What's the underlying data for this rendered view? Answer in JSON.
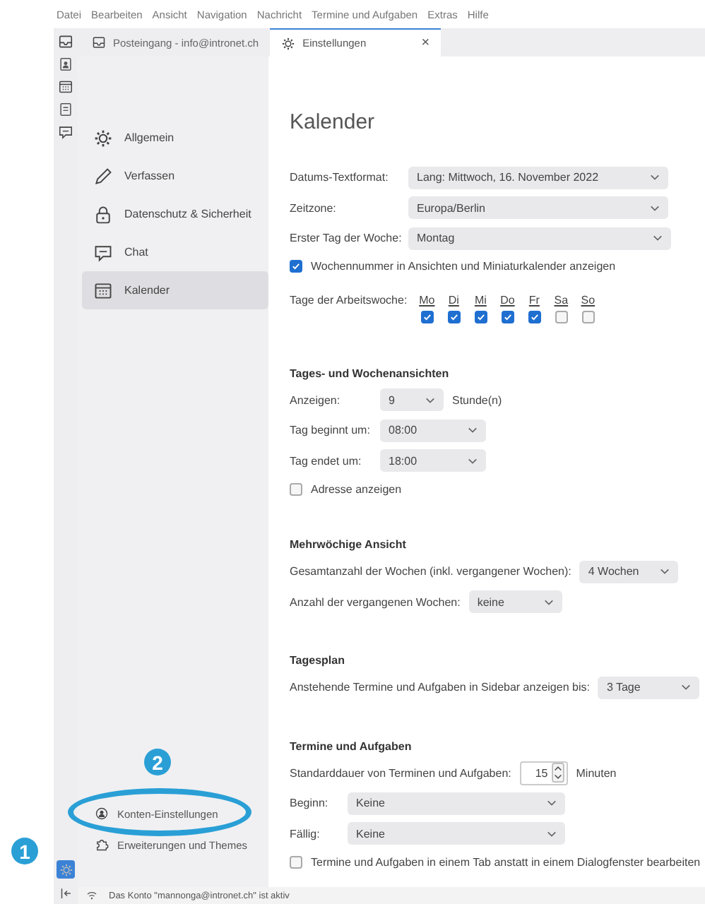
{
  "menu": [
    "Datei",
    "Bearbeiten",
    "Ansicht",
    "Navigation",
    "Nachricht",
    "Termine und Aufgaben",
    "Extras",
    "Hilfe"
  ],
  "tabs": [
    {
      "label": "Posteingang - info@intronet.ch",
      "selected": false
    },
    {
      "label": "Einstellungen",
      "selected": true,
      "close": "×"
    }
  ],
  "sidebar": {
    "items": [
      {
        "label": "Allgemein",
        "selected": false
      },
      {
        "label": "Verfassen",
        "selected": false
      },
      {
        "label": "Datenschutz & Sicherheit",
        "selected": false
      },
      {
        "label": "Chat",
        "selected": false
      },
      {
        "label": "Kalender",
        "selected": true
      }
    ],
    "footer": [
      {
        "label": "Konten-Einstellungen"
      },
      {
        "label": "Erweiterungen und Themes"
      }
    ]
  },
  "content": {
    "title": "Kalender",
    "sections": [
      {
        "rows": [
          {
            "kind": "select",
            "label": "Datums-Textformat:",
            "value": "Lang: Mittwoch, 16. November 2022"
          },
          {
            "kind": "select",
            "label": "Zeitzone:",
            "value": "Europa/Berlin"
          },
          {
            "kind": "select",
            "label": "Erster Tag der Woche:",
            "value": "Montag"
          },
          {
            "kind": "checkbox",
            "label": "Wochennummer in Ansichten und Miniaturkalender anzeigen",
            "checked": true
          },
          {
            "kind": "weekdays",
            "label": "Tage der Arbeitswoche:",
            "days": [
              {
                "label": "Mo",
                "checked": true
              },
              {
                "label": "Di",
                "checked": true
              },
              {
                "label": "Mi",
                "checked": true
              },
              {
                "label": "Do",
                "checked": true
              },
              {
                "label": "Fr",
                "checked": true
              },
              {
                "label": "Sa",
                "checked": false
              },
              {
                "label": "So",
                "checked": false
              }
            ]
          }
        ]
      },
      {
        "heading": "Tages- und Wochenansichten",
        "rows": [
          {
            "kind": "select",
            "label": "Anzeigen:",
            "value": "9",
            "suffix": "Stunde(n)"
          },
          {
            "kind": "select",
            "label": "Tag beginnt um:",
            "value": "08:00"
          },
          {
            "kind": "select",
            "label": "Tag endet um:",
            "value": "18:00"
          },
          {
            "kind": "checkbox",
            "label": "Adresse anzeigen",
            "checked": false
          }
        ]
      },
      {
        "heading": "Mehrwöchige Ansicht",
        "rows": [
          {
            "kind": "select",
            "label": "Gesamtanzahl der Wochen (inkl. vergangener Wochen):",
            "value": "4 Wochen"
          },
          {
            "kind": "select",
            "label": "Anzahl der vergangenen Wochen:",
            "value": "keine"
          }
        ]
      },
      {
        "heading": "Tagesplan",
        "rows": [
          {
            "kind": "select",
            "label": "Anstehende Termine und Aufgaben in Sidebar anzeigen bis:",
            "value": "3 Tage"
          }
        ]
      },
      {
        "heading": "Termine und Aufgaben",
        "rows": [
          {
            "kind": "spinner",
            "label": "Standarddauer von Terminen und Aufgaben:",
            "value": "15",
            "suffix": "Minuten"
          },
          {
            "kind": "select",
            "label": "Beginn:",
            "value": "Keine"
          },
          {
            "kind": "select",
            "label": "Fällig:",
            "value": "Keine"
          },
          {
            "kind": "checkbox",
            "label": "Termine und Aufgaben in einem Tab anstatt in einem Dialogfenster bearbeiten",
            "checked": false
          }
        ]
      }
    ]
  },
  "annotations": [
    {
      "text": "1"
    },
    {
      "text": "2"
    }
  ],
  "status_bar": {
    "text": "Das Konto \"mannonga@intronet.ch\" ist aktiv"
  }
}
